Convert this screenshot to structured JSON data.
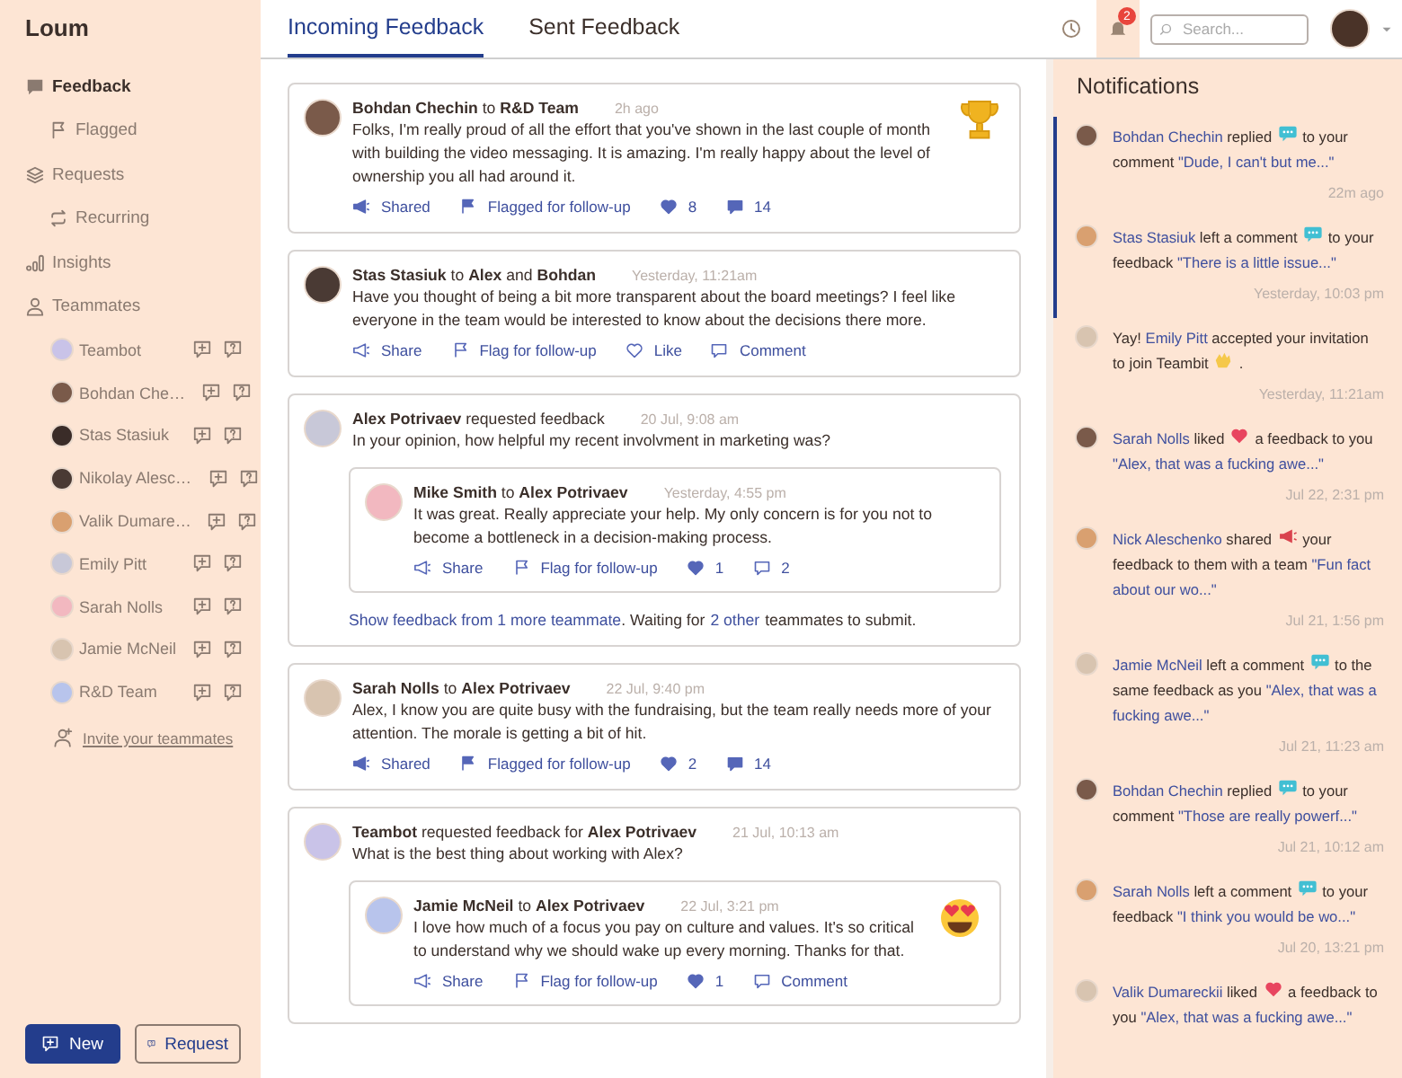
{
  "sidebar": {
    "brand": "Loum",
    "nav": [
      {
        "label": "Feedback",
        "selected": true,
        "children": [
          {
            "label": "Flagged",
            "selected": false
          }
        ]
      },
      {
        "label": "Requests",
        "selected": false,
        "children": [
          {
            "label": "Recurring",
            "selected": false
          }
        ]
      },
      {
        "label": "Insights",
        "selected": false
      },
      {
        "label": "Teammates",
        "selected": false
      }
    ],
    "teammates": [
      "Teambot",
      "Bohdan Che…",
      "Stas Stasiuk",
      "Nikolay Alesc…",
      "Valik Dumare…",
      "Emily Pitt",
      "Sarah Nolls",
      "Jamie McNeil",
      "R&D Team"
    ],
    "invite": "Invite your teammates",
    "buttons": [
      {
        "label": "New",
        "kind": "primary"
      },
      {
        "label": "Request",
        "kind": "secondary"
      }
    ]
  },
  "tabs": [
    {
      "label": "Incoming Feedback",
      "selected": true
    },
    {
      "label": "Sent Feedback",
      "selected": false
    }
  ],
  "toolbar": {
    "badge": "2",
    "search_placeholder": "Search..."
  },
  "feed": [
    {
      "head": "**Bohdan Chechin** to **R&D Team**",
      "time": "2h ago",
      "kind": "trophy",
      "body": "Folks, I'm really proud of all the effort that you've shown in the last couple of month with building the video messaging. It is amazing. I'm really happy about the level of ownership you all had around it.",
      "actions": [
        {
          "kind": "share",
          "label": "Shared",
          "on": true
        },
        {
          "kind": "flag",
          "label": "Flagged for follow-up",
          "on": true
        },
        {
          "kind": "like",
          "label": "8",
          "on": true
        },
        {
          "kind": "comment",
          "label": "14",
          "on": true
        }
      ]
    },
    {
      "head": "**Stas Stasiuk** to **Alex** and **Bohdan**",
      "time": "Yesterday, 11:21am",
      "body": "Have you thought of being a bit more transparent about the board meetings? I feel like everyone in the team would be interested to know about the decisions there more.",
      "actions": [
        {
          "kind": "share",
          "label": "Share",
          "on": false
        },
        {
          "kind": "flag",
          "label": "Flag for follow-up",
          "on": false
        },
        {
          "kind": "like",
          "label": "Like",
          "on": false
        },
        {
          "kind": "comment",
          "label": "Comment",
          "on": false
        }
      ]
    },
    {
      "head": "**Alex Potrivaev** requested feedback",
      "time": "20 Jul, 9:08 am",
      "body": "In your opinion, how helpful my recent involvment in marketing was?",
      "reply": {
        "head": "**Mike Smith** to **Alex Potrivaev**",
        "time": "Yesterday, 4:55 pm",
        "body": "It was great. Really appreciate your help. My only concern is for you not to become a bottleneck in a decision-making process.",
        "actions": [
          {
            "kind": "share",
            "label": "Share",
            "on": false
          },
          {
            "kind": "flag",
            "label": "Flag for follow-up",
            "on": false
          },
          {
            "kind": "like",
            "label": "1",
            "on": true
          },
          {
            "kind": "comment",
            "label": "2",
            "on": false
          }
        ]
      },
      "footer": [
        {
          "text": "Show feedback from 1 more teammate",
          "link": true
        },
        {
          "text": ". Waiting for",
          "link": false
        },
        {
          "text": "2 other",
          "link": true
        },
        {
          "text": "teammates to submit.",
          "link": false
        }
      ]
    },
    {
      "head": "**Sarah Nolls** to **Alex Potrivaev**",
      "time": "22 Jul, 9:40 pm",
      "body": "Alex, I know you are quite busy with the fundraising, but the team really needs more of your attention. The morale is getting a bit of hit.",
      "actions": [
        {
          "kind": "share",
          "label": "Shared",
          "on": true
        },
        {
          "kind": "flag",
          "label": "Flagged for follow-up",
          "on": true
        },
        {
          "kind": "like",
          "label": "2",
          "on": true
        },
        {
          "kind": "comment",
          "label": "14",
          "on": true
        }
      ]
    },
    {
      "head": "**Teambot** requested feedback for **Alex Potrivaev**",
      "time": "21 Jul, 10:13 am",
      "body": "What is the best thing about working with Alex?",
      "reply": {
        "head": "**Jamie McNeil** to **Alex Potrivaev**",
        "time": "22 Jul, 3:21 pm",
        "kind": "heart-eyes",
        "body": "I love how much of a focus you pay on culture and values. It's so critical to understand why we should wake up every morning. Thanks for that.",
        "actions": [
          {
            "kind": "share",
            "label": "Share",
            "on": false
          },
          {
            "kind": "flag",
            "label": "Flag for follow-up",
            "on": false
          },
          {
            "kind": "like",
            "label": "1",
            "on": true
          },
          {
            "kind": "comment",
            "label": "Comment",
            "on": false
          }
        ]
      }
    }
  ],
  "notifications": {
    "title": "Notifications",
    "items": [
      {
        "unread": true,
        "actor": "Bohdan Chechin",
        "verb": "replied",
        "kind": "comment",
        "rest": "to your comment",
        "quote": "\"Dude, I can't but me...\"",
        "time": "22m ago"
      },
      {
        "unread": true,
        "actor": "Stas Stasiuk",
        "verb": "left a comment",
        "kind": "comment",
        "rest": "to your feedback",
        "quote": "\"There is a little issue...\"",
        "time": "Yesterday, 10:03 pm"
      },
      {
        "unread": false,
        "prefix": "Yay!",
        "actor": "Emily Pitt",
        "verb": "accepted your invitation to join Teambit",
        "kind": "clap",
        "rest": ".",
        "time": "Yesterday, 11:21am"
      },
      {
        "unread": false,
        "actor": "Sarah Nolls",
        "verb": "liked",
        "kind": "heart",
        "rest": "a feedback to you",
        "quote": "\"Alex, that was a fucking awe...\"",
        "time": "Jul 22, 2:31 pm"
      },
      {
        "unread": false,
        "actor": "Nick Aleschenko",
        "verb": "shared",
        "kind": "megaphone",
        "rest": "your feedback to them with a team",
        "quote": "\"Fun fact about our wo...\"",
        "time": "Jul 21, 1:56 pm"
      },
      {
        "unread": false,
        "actor": "Jamie McNeil",
        "verb": "left a comment",
        "kind": "comment",
        "rest": "to the same feedback as you",
        "quote": "\"Alex, that was a fucking awe...\"",
        "time": "Jul 21, 11:23 am"
      },
      {
        "unread": false,
        "actor": "Bohdan Chechin",
        "verb": "replied",
        "kind": "comment",
        "rest": "to your comment",
        "quote": "\"Those are really powerf...\"",
        "time": "Jul 21, 10:12 am"
      },
      {
        "unread": false,
        "actor": "Sarah Nolls",
        "verb": "left a comment",
        "kind": "comment",
        "rest": "to your feedback",
        "quote": "\"I think you would be wo...\"",
        "time": "Jul 20, 13:21 pm"
      },
      {
        "unread": false,
        "actor": "Valik Dumareckii",
        "verb": "liked",
        "kind": "heart",
        "rest": "a feedback to you",
        "quote": "\"Alex, that was a fucking awe...\""
      }
    ]
  }
}
